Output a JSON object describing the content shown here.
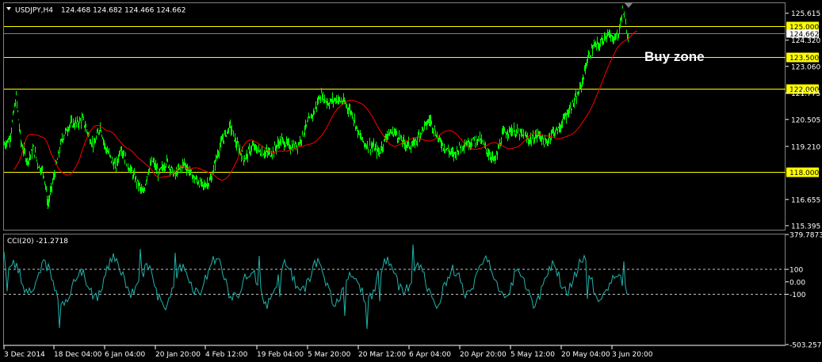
{
  "header": {
    "symbol": "USDJPY,H4",
    "ohlc": "124.468 124.682 124.466 124.662"
  },
  "annotation": {
    "text": "Buy zone"
  },
  "price_axis": {
    "ticks": [
      {
        "label": "125.615",
        "value": 125.615
      },
      {
        "label": "124.320",
        "value": 124.32
      },
      {
        "label": "123.060",
        "value": 123.06
      },
      {
        "label": "121.775",
        "value": 121.775
      },
      {
        "label": "120.505",
        "value": 120.505
      },
      {
        "label": "119.210",
        "value": 119.21
      },
      {
        "label": "116.655",
        "value": 116.655
      },
      {
        "label": "115.395",
        "value": 115.395
      }
    ],
    "range": [
      115.2,
      126.1
    ]
  },
  "levels": [
    {
      "label": "125.000",
      "value": 125.0
    },
    {
      "label": "123.500",
      "value": 123.5
    },
    {
      "label": "122.000",
      "value": 122.0
    },
    {
      "label": "118.000",
      "value": 118.0
    }
  ],
  "current_price": {
    "label": "124.662",
    "value": 124.662
  },
  "indicator": {
    "title": "CCI(20) -21.2718",
    "ticks": [
      {
        "label": "379.7873",
        "value": 379.7873
      },
      {
        "label": "100",
        "value": 100
      },
      {
        "label": "0.00",
        "value": 0
      },
      {
        "label": "-100",
        "value": -100
      },
      {
        "label": "-503.2579",
        "value": -503.2579
      }
    ]
  },
  "time_axis": {
    "labels": [
      "3 Dec 2014",
      "18 Dec 04:00",
      "6 Jan 04:00",
      "20 Jan 20:00",
      "4 Feb 12:00",
      "19 Feb 04:00",
      "5 Mar 20:00",
      "20 Mar 12:00",
      "6 Apr 04:00",
      "20 Apr 20:00",
      "5 May 12:00",
      "20 May 04:00",
      "3 Jun 20:00"
    ]
  },
  "colors": {
    "price": "#00ff00",
    "ma": "#ff0000",
    "cci": "#20b2aa",
    "level": "#ffff00",
    "grid": "#808080"
  }
}
